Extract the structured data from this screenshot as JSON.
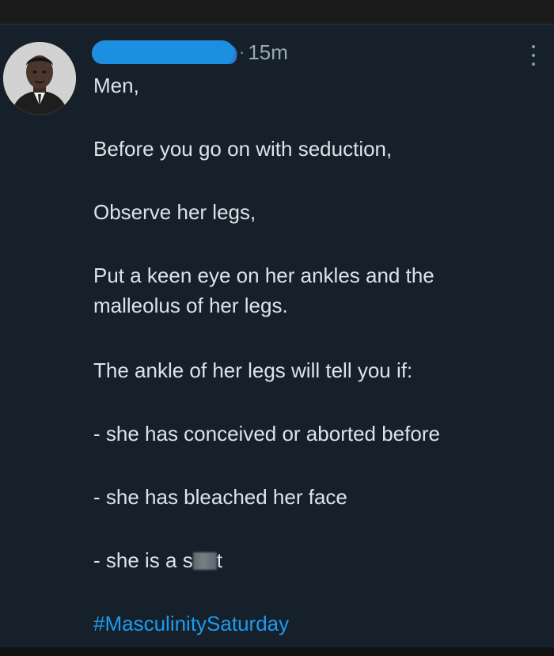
{
  "tweet": {
    "author_name_redacted": true,
    "separator": "·",
    "time": "15m",
    "more_icon": "more-vertical-icon",
    "lines": {
      "l1": "Men,",
      "l2": "Before you go on with seduction,",
      "l3": "Observe her legs,",
      "l4": "Put a keen eye on her ankles and the",
      "l5": "malleolus of her legs.",
      "l6": "The ankle of her legs will tell you if:",
      "l7": "- she has conceived or aborted before",
      "l8": "- she has bleached her face",
      "l9_prefix": "- she is a s",
      "l9_suffix": "t"
    },
    "hashtag": "#MasculinitySaturday",
    "colors": {
      "background": "#15202b",
      "text": "#dde3e8",
      "muted": "#8899a6",
      "link": "#1d9bf0"
    }
  }
}
